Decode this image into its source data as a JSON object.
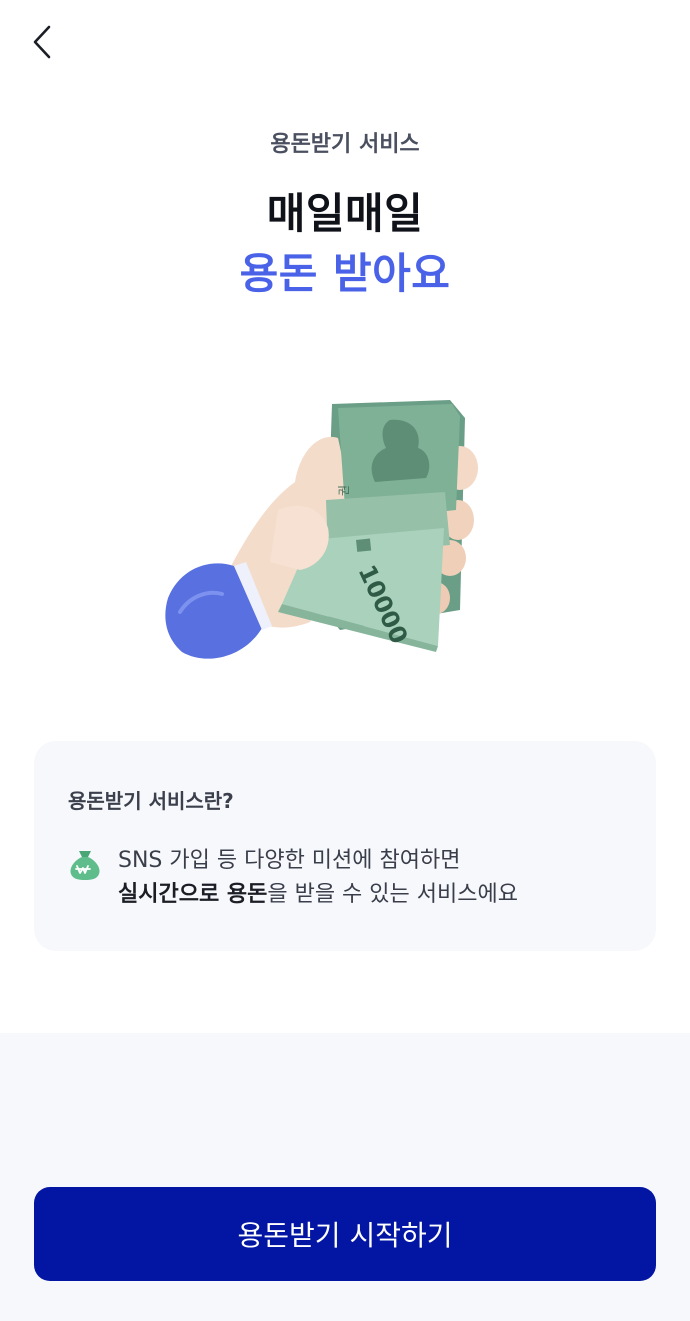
{
  "header": {
    "back_icon": "chevron-left-icon"
  },
  "hero": {
    "eyebrow": "용돈받기 서비스",
    "title_line1": "매일매일",
    "title_line2": "용돈 받아요",
    "illustration": "hand-holding-cash-icon",
    "banknote_text": "10000",
    "banknote_mark": "권"
  },
  "info": {
    "title": "용돈받기 서비스란?",
    "icon": "money-bag-icon",
    "line1": "SNS 가입 등 다양한 미션에 참여하면",
    "line2_bold": "실시간으로 용돈",
    "line2_rest": "을 받을 수 있는 서비스에요"
  },
  "cta": {
    "start_label": "용돈받기 시작하기"
  },
  "colors": {
    "accent": "#4a62e8",
    "button": "#0215a3",
    "card_bg": "#f7f8fc",
    "bottom_bg": "#f7f8fc",
    "bag_green": "#5fbd8b"
  }
}
